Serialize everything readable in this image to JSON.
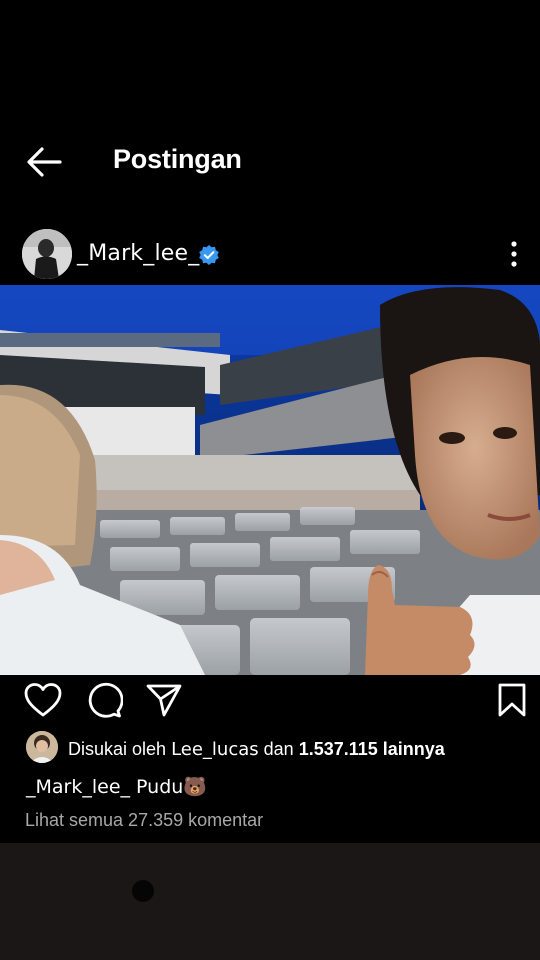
{
  "header": {
    "title": "Postingan",
    "back_icon": "arrow-left-icon"
  },
  "post": {
    "username": "_Mark_lee_",
    "verified_icon": "verified-badge-icon",
    "more_icon": "more-vertical-icon",
    "actions": {
      "like_icon": "heart-icon",
      "comment_icon": "comment-icon",
      "share_icon": "send-icon",
      "save_icon": "bookmark-icon"
    },
    "likes": {
      "prefix": "Disukai oleh ",
      "liker": "Lee_lucas",
      "middle": " dan ",
      "count": "1.537.115 lainnya"
    },
    "caption": {
      "username": "_Mark_lee_",
      "text": " Pudu🐻"
    },
    "view_comments": "Lihat semua 27.359 komentar"
  },
  "colors": {
    "background": "#000000",
    "verified": "#3897f0",
    "muted_text": "#a8a8a8",
    "bottom_bar": "#1a1716"
  }
}
